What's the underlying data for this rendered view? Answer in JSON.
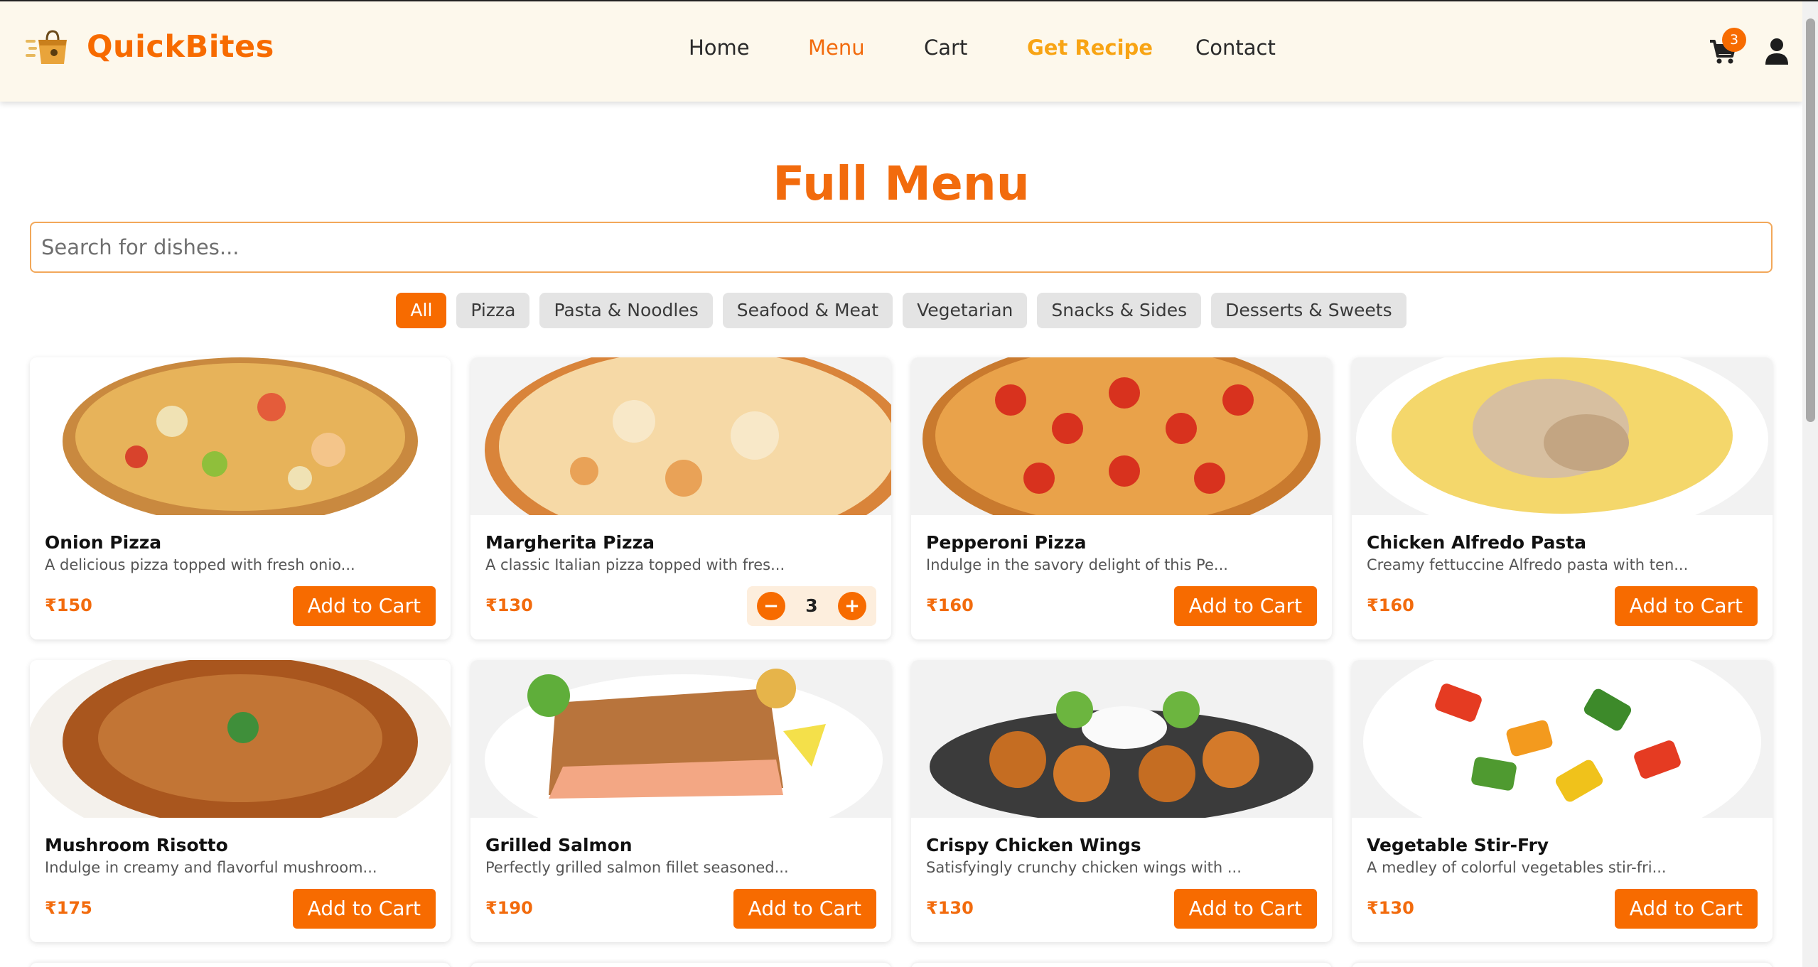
{
  "app": {
    "brand": "QuickBites",
    "brand_icon": "shopping-bag-speed-icon"
  },
  "nav": {
    "home": "Home",
    "menu": "Menu",
    "cart": "Cart",
    "recipe": "Get Recipe",
    "contact": "Contact",
    "cart_count": "3",
    "cart_icon": "cart-icon",
    "user_icon": "user-icon"
  },
  "page": {
    "title": "Full Menu",
    "search_placeholder": "Search for dishes...",
    "search_value": ""
  },
  "filters": [
    "All",
    "Pizza",
    "Pasta & Noodles",
    "Seafood & Meat",
    "Vegetarian",
    "Snacks & Sides",
    "Desserts & Sweets"
  ],
  "active_filter": "All",
  "items": [
    {
      "name": "Onion Pizza",
      "desc": "A delicious pizza topped with fresh onio...",
      "price": "₹150",
      "button": "Add to Cart"
    },
    {
      "name": "Margherita Pizza",
      "desc": "A classic Italian pizza topped with fres...",
      "price": "₹130",
      "quantity": "3",
      "minus": "−",
      "plus": "+"
    },
    {
      "name": "Pepperoni Pizza",
      "desc": "Indulge in the savory delight of this Pe...",
      "price": "₹160",
      "button": "Add to Cart"
    },
    {
      "name": "Chicken Alfredo Pasta",
      "desc": "Creamy fettuccine Alfredo pasta with ten...",
      "price": "₹160",
      "button": "Add to Cart"
    },
    {
      "name": "Mushroom Risotto",
      "desc": "Indulge in creamy and flavorful mushroom...",
      "price": "₹175",
      "button": "Add to Cart"
    },
    {
      "name": "Grilled Salmon",
      "desc": "Perfectly grilled salmon fillet seasoned...",
      "price": "₹190",
      "button": "Add to Cart"
    },
    {
      "name": "Crispy Chicken Wings",
      "desc": "Satisfyingly crunchy chicken wings with ...",
      "price": "₹130",
      "button": "Add to Cart"
    },
    {
      "name": "Vegetable Stir-Fry",
      "desc": "A medley of colorful vegetables stir-fri...",
      "price": "₹130",
      "button": "Add to Cart"
    }
  ],
  "colors": {
    "accent": "#f76b00",
    "accent_text": "#f26b0d",
    "recipe": "#f8a414",
    "navbar_bg": "#fdf8ec",
    "chip_bg": "#e4e4e4"
  }
}
